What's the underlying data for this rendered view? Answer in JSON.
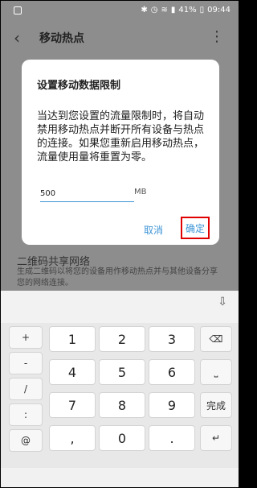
{
  "status": {
    "battery": "41%",
    "time": "09:44"
  },
  "appbar": {
    "title": "移动热点"
  },
  "background": {
    "section_title": "二维码共享网络",
    "section_desc": "生成二维码以将您的设备用作移动热点并与其他设备分享您的网络连接。"
  },
  "dialog": {
    "title": "设置移动数据限制",
    "body": "当达到您设置的流量限制时，将自动禁用移动热点并断开所有设备与热点的连接。如果您重新启用移动热点，流量使用量将重置为零。",
    "input_value": "500",
    "unit": "MB",
    "cancel_label": "取消",
    "ok_label": "确定"
  },
  "keyboard": {
    "keys": [
      "1",
      "2",
      "3",
      "4",
      "5",
      "6",
      "7",
      "8",
      "9",
      ",",
      "0",
      "."
    ],
    "left_keys": [
      "+",
      "-",
      "/",
      ":",
      "@"
    ],
    "done_label": "完成"
  }
}
